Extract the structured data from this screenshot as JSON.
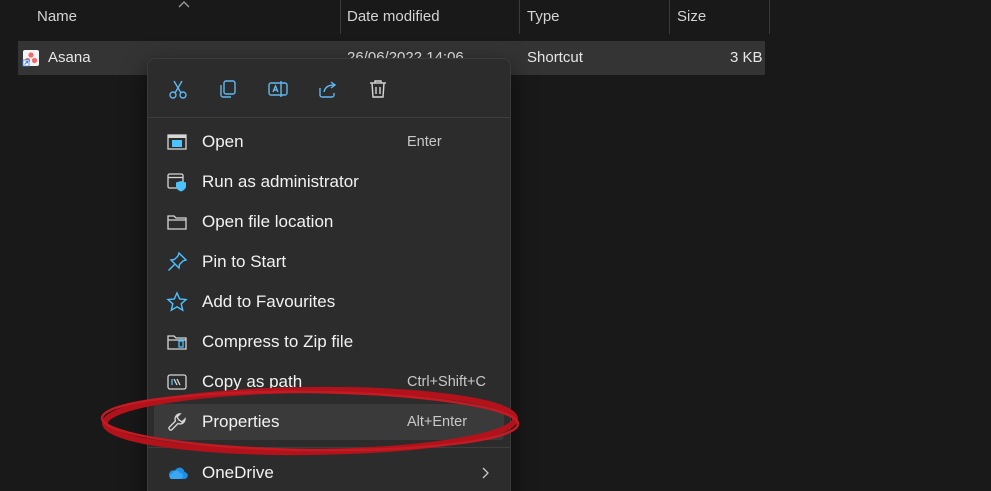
{
  "columns": {
    "name": "Name",
    "date_modified": "Date modified",
    "type": "Type",
    "size": "Size"
  },
  "file": {
    "name": "Asana",
    "date_modified": "26/06/2022 14:06",
    "type": "Shortcut",
    "size": "3 KB",
    "icon": "asana-shortcut-icon"
  },
  "quick_actions": [
    {
      "name": "cut",
      "icon": "scissors-icon"
    },
    {
      "name": "copy",
      "icon": "copy-icon"
    },
    {
      "name": "rename",
      "icon": "rename-icon"
    },
    {
      "name": "share",
      "icon": "share-icon"
    },
    {
      "name": "delete",
      "icon": "trash-icon"
    }
  ],
  "menu": {
    "items": [
      {
        "label": "Open",
        "shortcut": "Enter",
        "icon": "open-icon"
      },
      {
        "label": "Run as administrator",
        "shortcut": "",
        "icon": "admin-shield-icon"
      },
      {
        "label": "Open file location",
        "shortcut": "",
        "icon": "folder-icon"
      },
      {
        "label": "Pin to Start",
        "shortcut": "",
        "icon": "pin-icon"
      },
      {
        "label": "Add to Favourites",
        "shortcut": "",
        "icon": "star-icon"
      },
      {
        "label": "Compress to Zip file",
        "shortcut": "",
        "icon": "zip-folder-icon"
      },
      {
        "label": "Copy as path",
        "shortcut": "Ctrl+Shift+C",
        "icon": "copy-path-icon"
      },
      {
        "label": "Properties",
        "shortcut": "Alt+Enter",
        "icon": "wrench-icon"
      },
      {
        "label": "OneDrive",
        "shortcut": "",
        "icon": "onedrive-cloud-icon"
      }
    ],
    "highlighted_item": "Properties"
  },
  "colors": {
    "background": "#191919",
    "menu_background": "#2c2c2c",
    "accent_blue": "#4cc2ff",
    "annotation_red": "#b3121b"
  }
}
